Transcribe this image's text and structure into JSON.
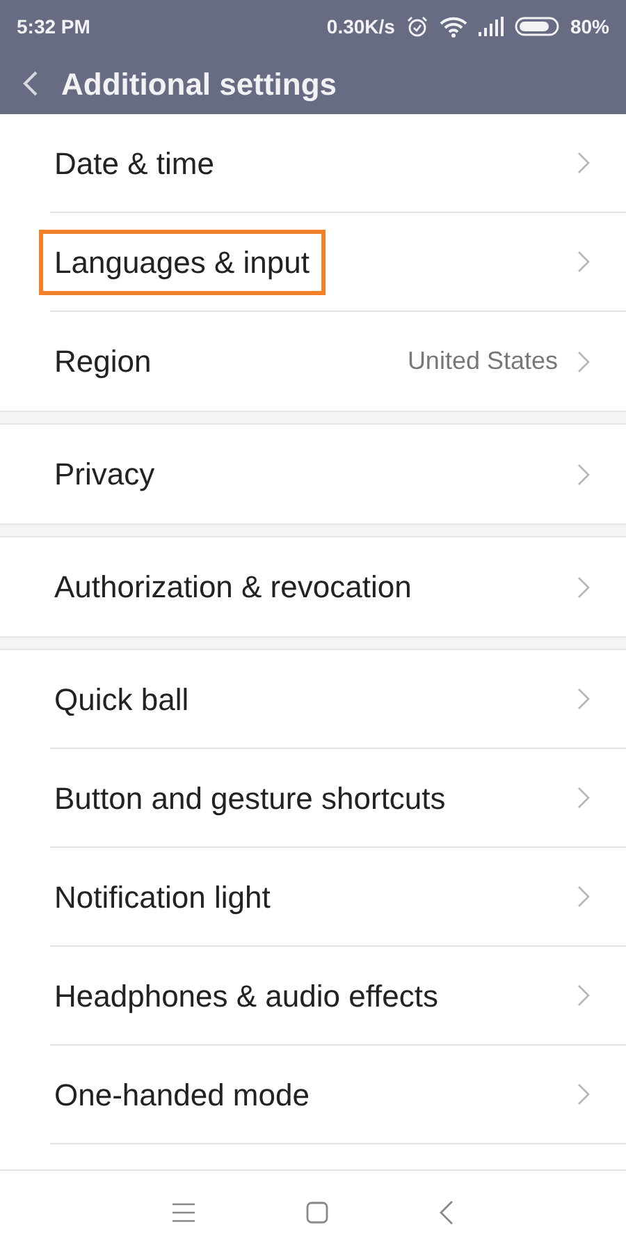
{
  "status_bar": {
    "time": "5:32 PM",
    "speed": "0.30K/s",
    "battery": "80%"
  },
  "header": {
    "title": "Additional settings"
  },
  "groups": [
    {
      "items": [
        {
          "label": "Date & time",
          "highlighted": false
        },
        {
          "label": "Languages & input",
          "highlighted": true
        },
        {
          "label": "Region",
          "value": "United States",
          "highlighted": false
        }
      ]
    },
    {
      "items": [
        {
          "label": "Privacy",
          "highlighted": false
        }
      ]
    },
    {
      "items": [
        {
          "label": "Authorization & revocation",
          "highlighted": false
        }
      ]
    },
    {
      "items": [
        {
          "label": "Quick ball",
          "highlighted": false
        },
        {
          "label": "Button and gesture shortcuts",
          "highlighted": false
        },
        {
          "label": "Notification light",
          "highlighted": false
        },
        {
          "label": "Headphones & audio effects",
          "highlighted": false
        },
        {
          "label": "One-handed mode",
          "highlighted": false
        }
      ]
    }
  ]
}
